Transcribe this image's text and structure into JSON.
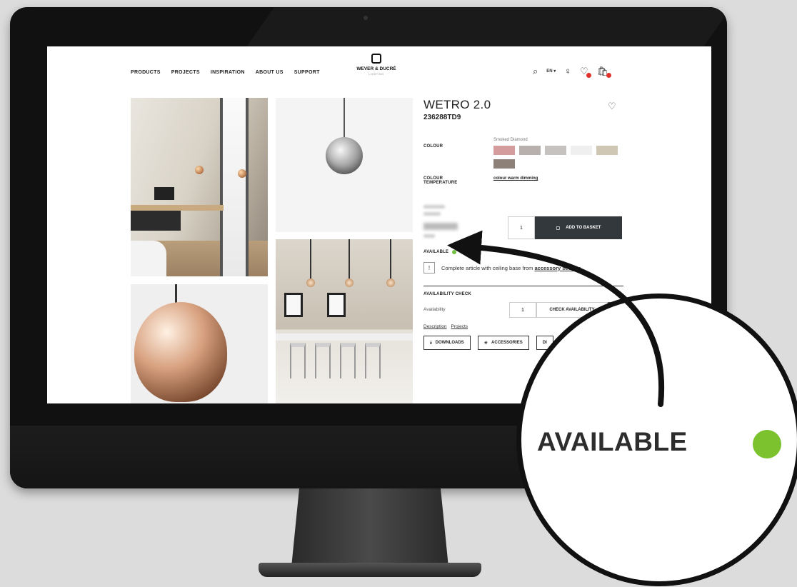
{
  "nav": {
    "links": [
      "PRODUCTS",
      "PROJECTS",
      "INSPIRATION",
      "ABOUT US",
      "SUPPORT"
    ],
    "logo": {
      "name": "WEVER & DUCRÉ",
      "sub": "LIGHTING"
    },
    "language": "EN ▾",
    "icons": [
      "search-icon",
      "user-icon",
      "wishlist-icon",
      "basket-icon"
    ]
  },
  "product": {
    "title": "WETRO 2.0",
    "sku": "236288TD9",
    "colour_label": "COLOUR",
    "colour_value": "Smoked Diamond",
    "swatch_colors": [
      "#d49c9c",
      "#b8b0ac",
      "#c5c2c0",
      "#efefef",
      "#cfc6b4",
      "#8c8079"
    ],
    "colour_temp_label": [
      "COLOUR",
      "TEMPERATURE"
    ],
    "colour_temp_value": "colour warm dimming",
    "quantity": "1",
    "add_to_basket": "ADD TO BASKET",
    "available": "AVAILABLE",
    "available_color": "#73c143",
    "notice_icon": "!",
    "notice_text": "Complete article with ceiling base from",
    "notice_link": "accessory section",
    "availability_check_title": "AVAILABILITY CHECK",
    "availability_label": "Availability",
    "availability_qty": "1",
    "check_availability": "CHECK AVAILABILITY",
    "tabs": [
      "Description",
      "Projects"
    ],
    "tiles": [
      "DOWNLOADS",
      "ACCESSORIES",
      "DI"
    ]
  },
  "magnifier": {
    "label": "AVAILABLE",
    "dot_color": "#7cc22e"
  }
}
